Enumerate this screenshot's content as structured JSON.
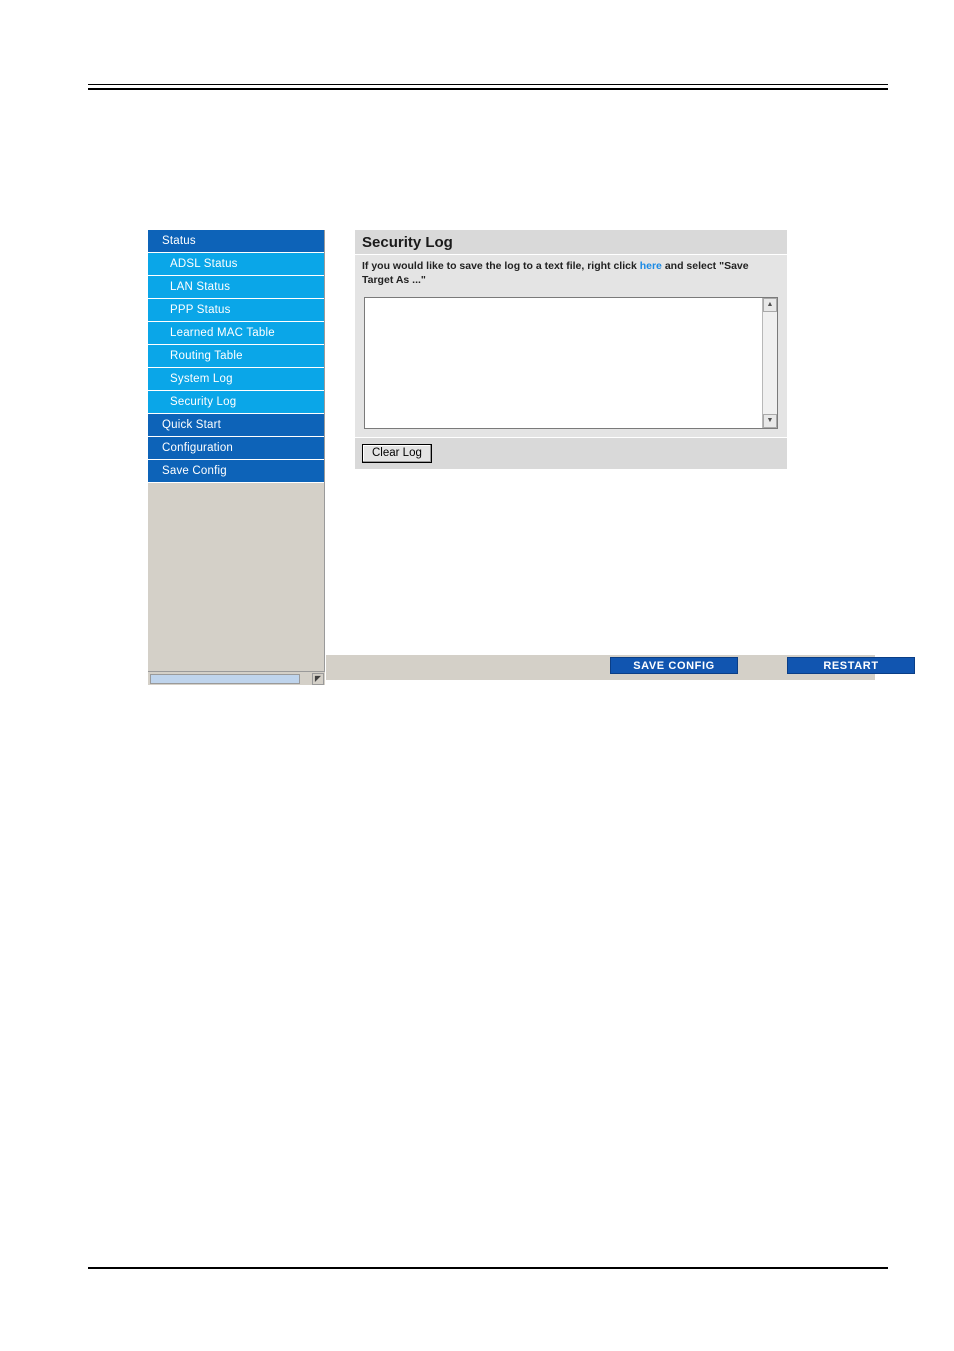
{
  "nav": {
    "items": [
      {
        "label": "Status",
        "type": "head"
      },
      {
        "label": "ADSL Status",
        "type": "sub"
      },
      {
        "label": "LAN Status",
        "type": "sub"
      },
      {
        "label": "PPP Status",
        "type": "sub"
      },
      {
        "label": "Learned MAC Table",
        "type": "sub"
      },
      {
        "label": "Routing Table",
        "type": "sub"
      },
      {
        "label": "System Log",
        "type": "sub"
      },
      {
        "label": "Security Log",
        "type": "sub"
      },
      {
        "label": "Quick Start",
        "type": "head"
      },
      {
        "label": "Configuration",
        "type": "head"
      },
      {
        "label": "Save Config",
        "type": "head"
      }
    ],
    "scrollbar": {
      "arrow_glyph": "◤"
    }
  },
  "panel": {
    "title": "Security Log",
    "description_before_link": "If you would like to save the log to a text file, right click ",
    "description_link": "here",
    "description_after_link": " and select \"Save Target As ...\"",
    "log_contents": "",
    "scrollbar": {
      "up_glyph": "▲",
      "down_glyph": "▼"
    },
    "clear_button": "Clear Log"
  },
  "actions": {
    "save_config": "SAVE CONFIG",
    "restart": "RESTART"
  },
  "colors": {
    "nav_head": "#0d63b8",
    "nav_sub": "#0aa6e8",
    "link": "#1a8ae5",
    "action_button": "#1155b0",
    "panel_header": "#d9d9d9",
    "panel_body": "#e4e4e4"
  }
}
